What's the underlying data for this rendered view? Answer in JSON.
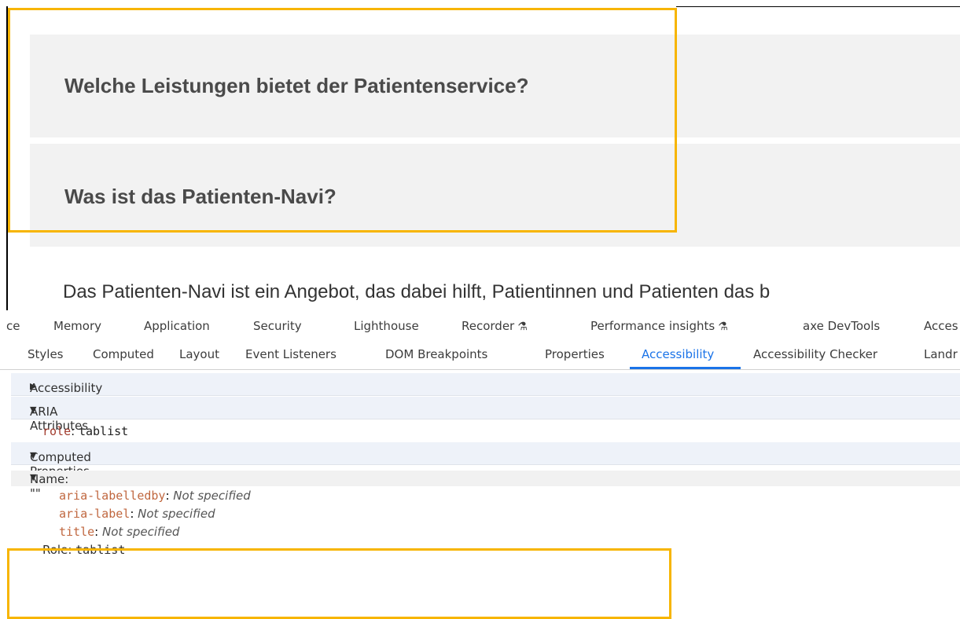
{
  "webpage": {
    "faq_items": [
      "Welche Leistungen bietet der Patientenservice?",
      "Was ist das Patienten-Navi?"
    ],
    "paragraph": "Das Patienten-Navi ist ein Angebot, das dabei hilft, Patientinnen und Patienten das b"
  },
  "devtools": {
    "main_tabs": [
      "ce",
      "Memory",
      "Application",
      "Security",
      "Lighthouse",
      "Recorder",
      "Performance insights",
      "axe DevTools",
      "Acces"
    ],
    "experimental_icon": "⚗",
    "sub_tabs": [
      "Styles",
      "Computed",
      "Layout",
      "Event Listeners",
      "DOM Breakpoints",
      "Properties",
      "Accessibility",
      "Accessibility Checker",
      "Landr"
    ],
    "active_sub_tab": "Accessibility",
    "sections": {
      "tree": "Accessibility Tree",
      "aria": "ARIA Attributes",
      "computed": "Computed Properties"
    },
    "aria_attr": {
      "key": "role",
      "value": "tablist"
    },
    "name_row": "Name: \"\"",
    "name_props": [
      {
        "key": "aria-labelledby",
        "value": "Not specified"
      },
      {
        "key": "aria-label",
        "value": "Not specified"
      },
      {
        "key": "title",
        "value": "Not specified"
      }
    ],
    "role_row": {
      "key": "Role",
      "value": "tablist"
    }
  },
  "colors": {
    "highlight": "#f7b500",
    "active_tab": "#1a73e8",
    "section_header_bg": "#eef2f9"
  }
}
